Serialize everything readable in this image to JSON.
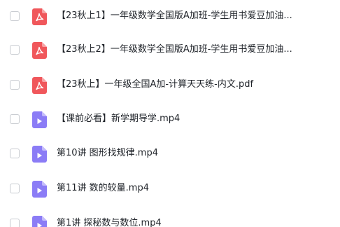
{
  "colors": {
    "pdf_icon": "#f0575b",
    "video_icon": "#8b7cf6",
    "text": "#1f2329",
    "checkbox_border": "#c9ccd1"
  },
  "files": [
    {
      "name": "【23秋上1】一年级数学全国版A加班-学生用书爱豆加油...",
      "type": "pdf",
      "icon": "pdf-icon"
    },
    {
      "name": "【23秋上2】一年级数学全国版A加班-学生用书爱豆加油...",
      "type": "pdf",
      "icon": "pdf-icon"
    },
    {
      "name": "【23秋上】一年级全国A加-计算天天练-内文.pdf",
      "type": "pdf",
      "icon": "pdf-icon"
    },
    {
      "name": "【课前必看】新学期导学.mp4",
      "type": "video",
      "icon": "video-icon"
    },
    {
      "name": "第10讲 图形找规律.mp4",
      "type": "video",
      "icon": "video-icon"
    },
    {
      "name": "第11讲 数的较量.mp4",
      "type": "video",
      "icon": "video-icon"
    },
    {
      "name": "第1讲 探秘数与数位.mp4",
      "type": "video",
      "icon": "video-icon"
    }
  ]
}
